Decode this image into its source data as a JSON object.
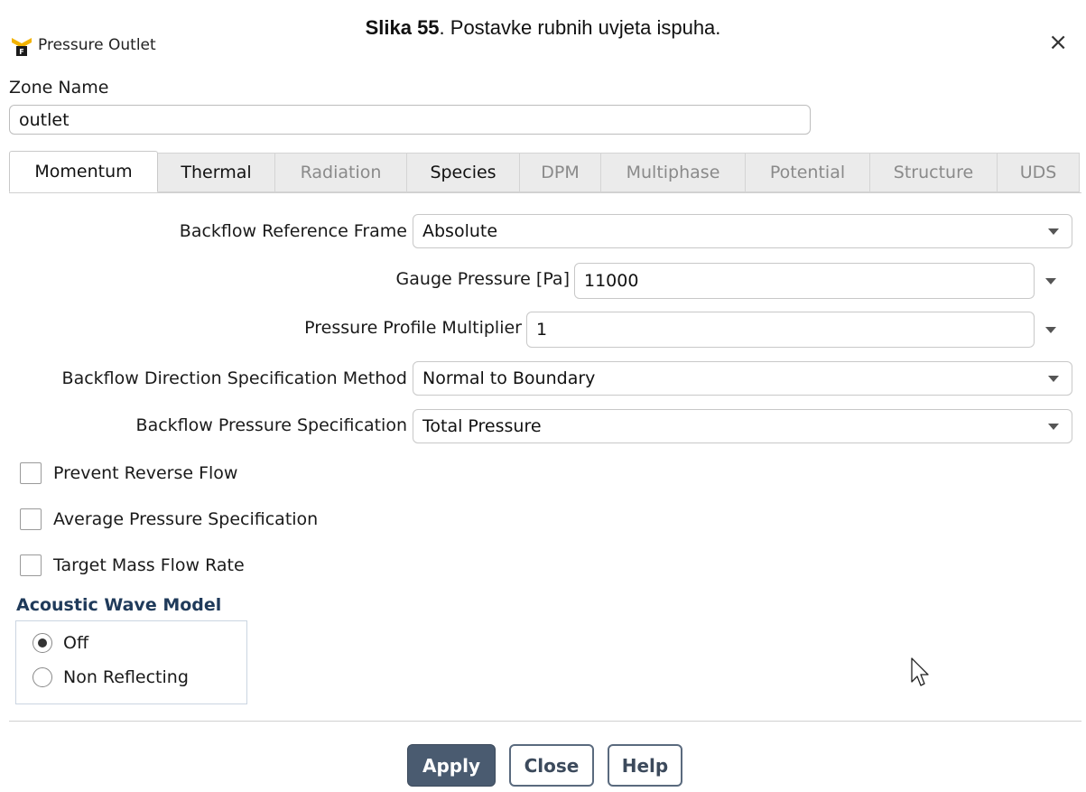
{
  "caption": {
    "bold": "Slika 55",
    "rest": ". Postavke rubnih uvjeta ispuha."
  },
  "window": {
    "title": "Pressure Outlet",
    "close_glyph": "×"
  },
  "zone": {
    "label": "Zone Name",
    "value": "outlet"
  },
  "tabs": [
    {
      "label": "Momentum",
      "state": "active"
    },
    {
      "label": "Thermal",
      "state": "enabled"
    },
    {
      "label": "Radiation",
      "state": "disabled"
    },
    {
      "label": "Species",
      "state": "enabled"
    },
    {
      "label": "DPM",
      "state": "disabled"
    },
    {
      "label": "Multiphase",
      "state": "disabled"
    },
    {
      "label": "Potential",
      "state": "disabled"
    },
    {
      "label": "Structure",
      "state": "disabled"
    },
    {
      "label": "UDS",
      "state": "disabled"
    }
  ],
  "momentum": {
    "backflow_frame": {
      "label": "Backflow Reference Frame",
      "value": "Absolute"
    },
    "gauge_pressure": {
      "label": "Gauge Pressure [Pa]",
      "value": "11000"
    },
    "profile_multiplier": {
      "label": "Pressure Profile Multiplier",
      "value": "1"
    },
    "backflow_direction": {
      "label": "Backflow Direction Specification Method",
      "value": "Normal to Boundary"
    },
    "backflow_pressure": {
      "label": "Backflow Pressure Specification",
      "value": "Total Pressure"
    },
    "checkboxes": {
      "prevent_reverse": {
        "label": "Prevent Reverse Flow",
        "checked": false
      },
      "average_pressure": {
        "label": "Average Pressure Specification",
        "checked": false
      },
      "target_mass_flow": {
        "label": "Target Mass Flow Rate",
        "checked": false
      }
    },
    "acoustic": {
      "title": "Acoustic Wave Model",
      "off": {
        "label": "Off",
        "selected": true
      },
      "non_reflecting": {
        "label": "Non Reflecting",
        "selected": false
      }
    }
  },
  "buttons": {
    "apply": "Apply",
    "close": "Close",
    "help": "Help"
  },
  "colors": {
    "accent": "#4a5b70",
    "group_title": "#1f3a5a",
    "tab_inactive_bg": "#ebebeb"
  },
  "icons": {
    "app": "fluent-app-icon",
    "cursor": "mouse-pointer-icon"
  }
}
